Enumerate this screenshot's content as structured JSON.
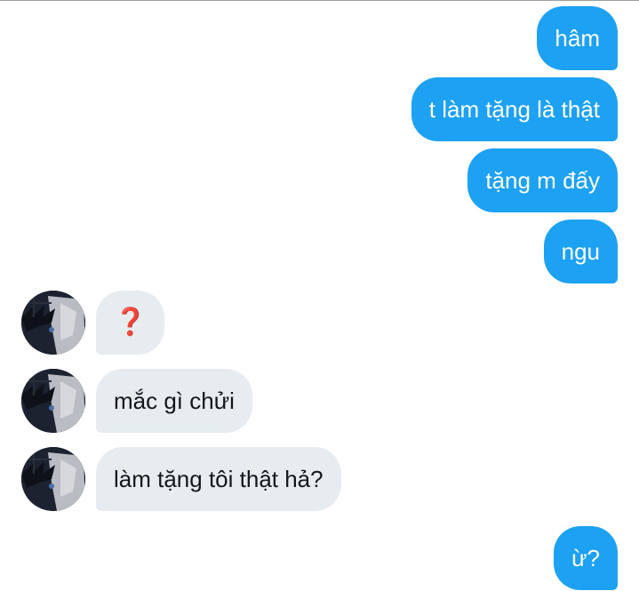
{
  "messages": [
    {
      "side": "out",
      "text": "hâm"
    },
    {
      "side": "out",
      "text": "t làm tặng là thật"
    },
    {
      "side": "out",
      "text": "tặng m đấy"
    },
    {
      "side": "out",
      "text": "ngu"
    },
    {
      "side": "in",
      "text": "❓"
    },
    {
      "side": "in",
      "text": "mắc gì chửi"
    },
    {
      "side": "in",
      "text": "làm tặng tôi thật hả?"
    },
    {
      "side": "out",
      "text": "ừ?"
    }
  ],
  "colors": {
    "outgoing_bubble": "#1da1f2",
    "incoming_bubble": "#e6ecf0",
    "question_mark": "#e0453a"
  },
  "icons": {
    "avatar": "anime-character-avatar",
    "question_mark": "red-question-mark-emoji"
  }
}
